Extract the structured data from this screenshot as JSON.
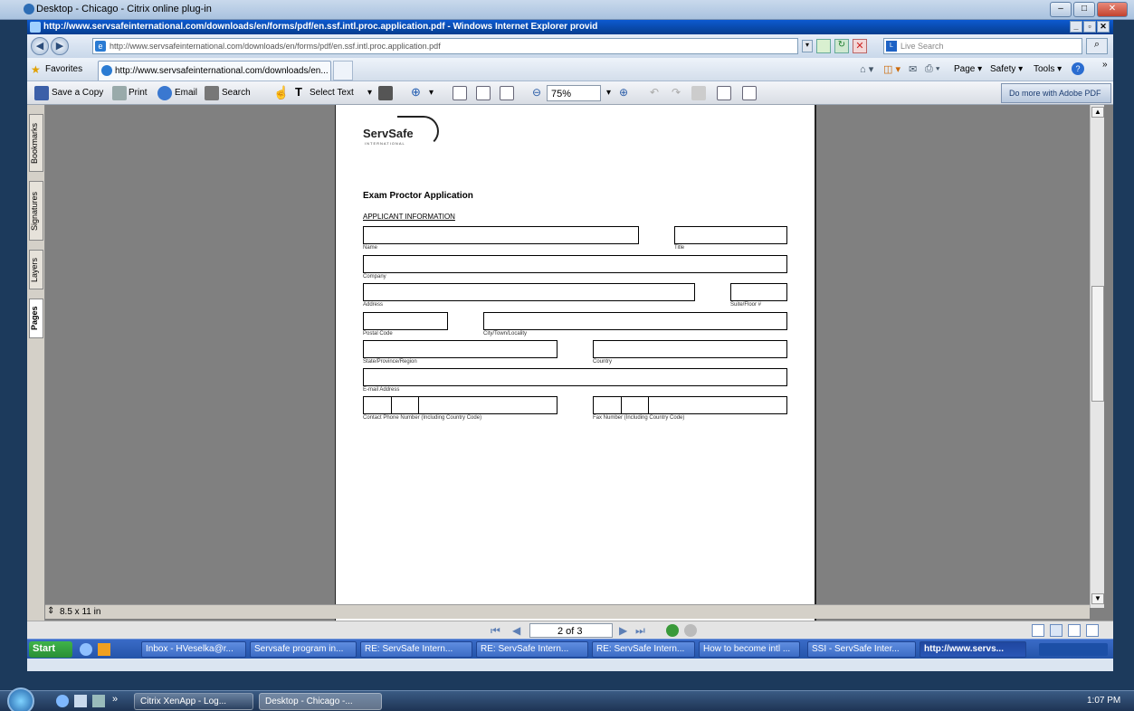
{
  "outer_window": {
    "title": "Desktop - Chicago - Citrix online plug-in"
  },
  "ie_window": {
    "title": "http://www.servsafeinternational.com/downloads/en/forms/pdf/en.ssf.intl.proc.application.pdf - Windows Internet Explorer provid"
  },
  "address_bar": {
    "url": "http://www.servsafeinternational.com/downloads/en/forms/pdf/en.ssf.intl.proc.application.pdf",
    "search_placeholder": "Live Search"
  },
  "favorites_bar": {
    "favorites_label": "Favorites",
    "tab_title": "http://www.servsafeinternational.com/downloads/en...",
    "page_label": "Page ▾",
    "safety_label": "Safety ▾",
    "tools_label": "Tools ▾"
  },
  "acrobat_toolbar": {
    "save_copy": "Save a Copy",
    "print": "Print",
    "email": "Email",
    "search": "Search",
    "select_text": "Select Text",
    "zoom": "75%",
    "more_adobe": "Do more with Adobe PDF"
  },
  "nav_panel": {
    "tabs": [
      "Bookmarks",
      "Signatures",
      "Layers",
      "Pages"
    ]
  },
  "page_size": "8.5 x 11 in",
  "pdf": {
    "logo": "ServSafe",
    "logo_sub": "INTERNATIONAL",
    "form_title": "Exam Proctor Application",
    "section_title": "APPLICANT INFORMATION",
    "fields": {
      "name": "Name",
      "title": "Title",
      "company": "Company",
      "address": "Address",
      "suite": "Suite/Floor #",
      "postal": "Postal Code",
      "city": "City/Town/Locality",
      "state": "State/Province/Region",
      "country": "Country",
      "email": "E-mail Address",
      "phone": "Contact Phone Number (Including Country Code)",
      "fax": "Fax Number (Including Country Code)"
    }
  },
  "page_nav": {
    "indicator": "2 of 3"
  },
  "xen_taskbar": {
    "start": "Start",
    "items": [
      "Inbox - HVeselka@r...",
      "Servsafe program in...",
      "RE: ServSafe Intern...",
      "RE: ServSafe Intern...",
      "RE: ServSafe Intern...",
      "How to become intl ...",
      "SSI - ServSafe Inter...",
      "http://www.servs..."
    ]
  },
  "win7_taskbar": {
    "items": [
      "Citrix XenApp - Log...",
      "Desktop - Chicago -..."
    ],
    "clock": "1:07 PM"
  }
}
